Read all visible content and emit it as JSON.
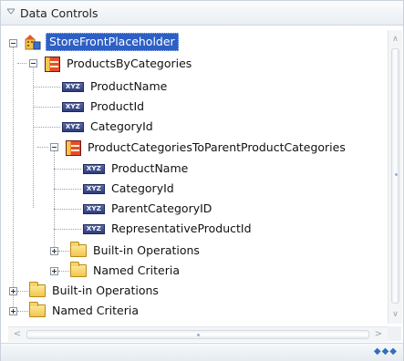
{
  "panel": {
    "title": "Data Controls",
    "header_icon": "triangle-down-icon"
  },
  "tree": {
    "root": {
      "label": "StoreFrontPlaceholder",
      "icon": "data-control-root-icon",
      "selected": true
    },
    "products_by_categories": {
      "label": "ProductsByCategories",
      "icon": "collection-icon"
    },
    "attr_product_name": {
      "label": "ProductName",
      "icon": "xyz-attribute-icon"
    },
    "attr_product_id": {
      "label": "ProductId",
      "icon": "xyz-attribute-icon"
    },
    "attr_category_id": {
      "label": "CategoryId",
      "icon": "xyz-attribute-icon"
    },
    "nested_collection": {
      "label": "ProductCategoriesToParentProductCategories",
      "icon": "collection-icon"
    },
    "n_attr_product_name": {
      "label": "ProductName",
      "icon": "xyz-attribute-icon"
    },
    "n_attr_category_id": {
      "label": "CategoryId",
      "icon": "xyz-attribute-icon"
    },
    "n_attr_parent_category_id": {
      "label": "ParentCategoryID",
      "icon": "xyz-attribute-icon"
    },
    "n_attr_representative_product_id": {
      "label": "RepresentativeProductId",
      "icon": "xyz-attribute-icon"
    },
    "n_builtin_ops": {
      "label": "Built-in Operations",
      "icon": "folder-icon"
    },
    "n_named_criteria": {
      "label": "Named Criteria",
      "icon": "folder-icon"
    },
    "builtin_ops": {
      "label": "Built-in Operations",
      "icon": "folder-icon"
    },
    "named_criteria": {
      "label": "Named Criteria",
      "icon": "folder-icon"
    }
  },
  "attribute_badge": "XYZ",
  "colors": {
    "selection": "#2d5fc4",
    "dots": "#2f6fbd",
    "folder": "#f2c64a"
  }
}
